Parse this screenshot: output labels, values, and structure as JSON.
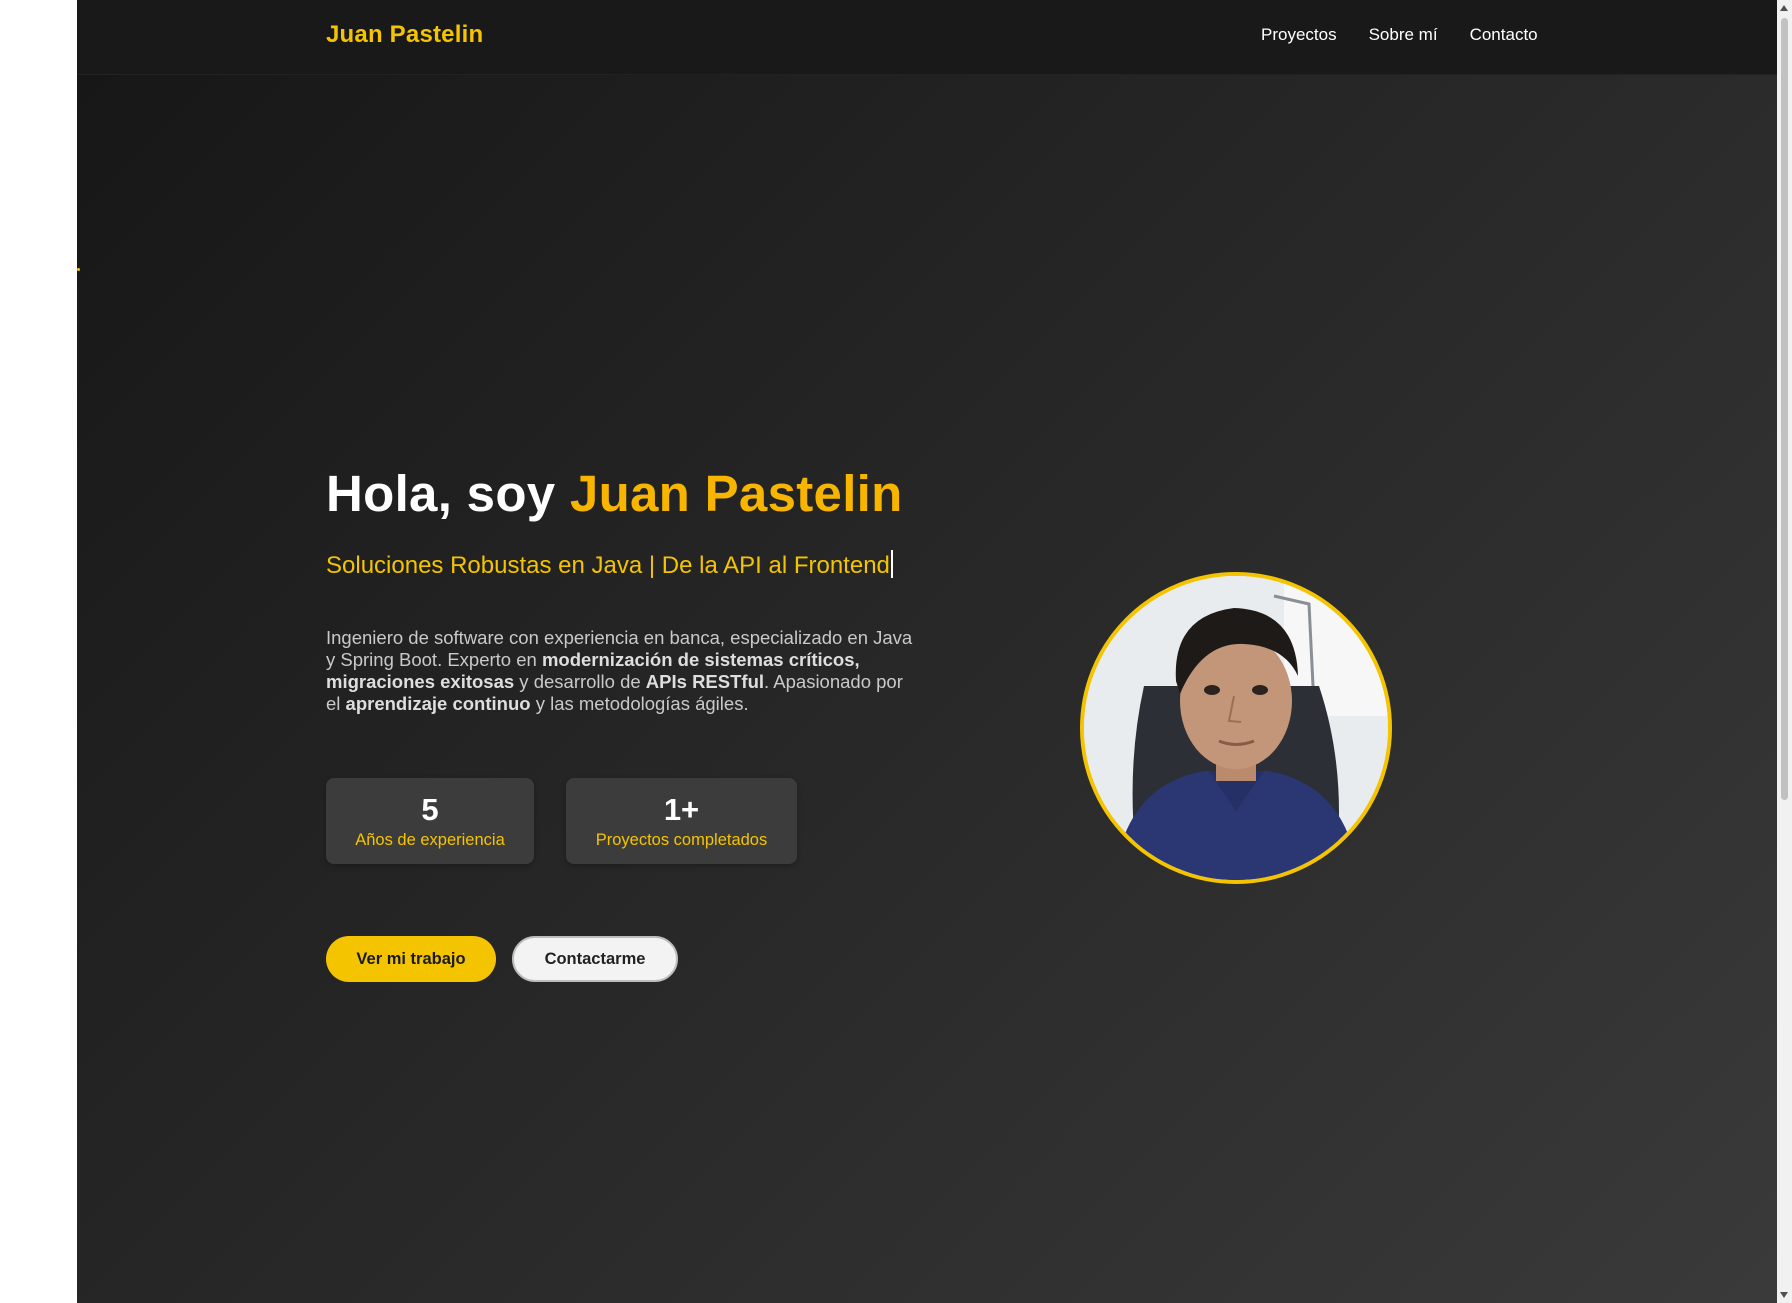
{
  "header": {
    "brand": "Juan Pastelin",
    "nav": [
      "Proyectos",
      "Sobre mí",
      "Contacto"
    ]
  },
  "hero": {
    "greeting": "Hola, soy ",
    "name": "Juan Pastelin",
    "tagline": "Soluciones Robustas en Java | De la API al Frontend",
    "bio": {
      "t1": "Ingeniero de software con experiencia en banca, especializado en Java y Spring Boot. Experto en ",
      "b1": "modernización de sistemas críticos, migraciones exitosas",
      "t2": " y desarrollo de ",
      "b2": "APIs RESTful",
      "t3": ". Apasionado por el ",
      "b3": "aprendizaje continuo",
      "t4": " y las metodologías ágiles."
    }
  },
  "stats": [
    {
      "number": "5",
      "label": "Años de experiencia"
    },
    {
      "number": "1+",
      "label": "Proyectos completados"
    }
  ],
  "actions": {
    "primary": "Ver mi trabajo",
    "secondary": "Contactarme"
  },
  "colors": {
    "accent": "#f5c400",
    "name_accent": "#f7b500",
    "background_dark": "#191919",
    "card": "#3c3c3c"
  },
  "icons": {
    "avatar": "profile-photo"
  }
}
